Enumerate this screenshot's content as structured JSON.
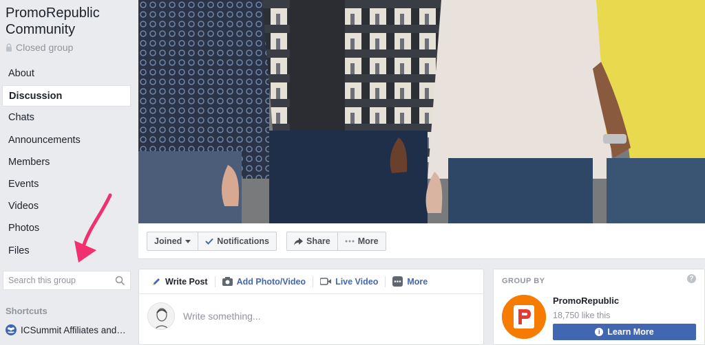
{
  "sidebar": {
    "title": "PromoRepublic Community",
    "privacy": "Closed group",
    "nav": [
      {
        "label": "About"
      },
      {
        "label": "Discussion"
      },
      {
        "label": "Chats"
      },
      {
        "label": "Announcements"
      },
      {
        "label": "Members"
      },
      {
        "label": "Events"
      },
      {
        "label": "Videos"
      },
      {
        "label": "Photos"
      },
      {
        "label": "Files"
      }
    ],
    "active_item": "Discussion",
    "search_placeholder": "Search this group",
    "shortcuts_header": "Shortcuts",
    "shortcut_item": "ICSummit Affiliates and…"
  },
  "action_bar": {
    "joined": "Joined",
    "notifications": "Notifications",
    "share": "Share",
    "more": "More"
  },
  "composer": {
    "tabs": [
      "Write Post",
      "Add Photo/Video",
      "Live Video",
      "More"
    ],
    "placeholder": "Write something..."
  },
  "group_by": {
    "header": "GROUP BY",
    "page_name": "PromoRepublic",
    "likes": "18,750 like this",
    "button": "Learn More"
  },
  "colors": {
    "accent": "#4267b2",
    "annotation_arrow": "#f0306f",
    "brand_logo": "#f57c00"
  }
}
